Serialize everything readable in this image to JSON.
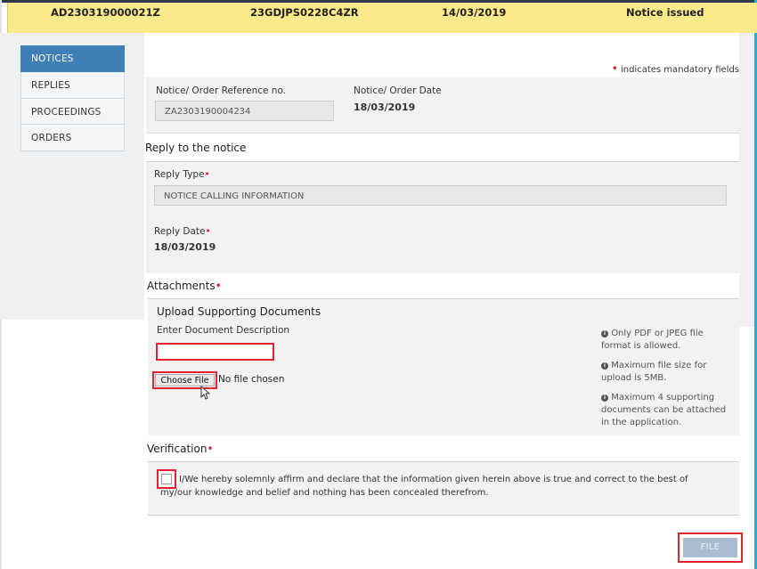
{
  "header": {
    "reference_id": "AD230319000021Z",
    "gstin": "23GDJPS0228C4ZR",
    "date": "14/03/2019",
    "status": "Notice issued"
  },
  "sidebar": {
    "items": [
      {
        "label": "NOTICES",
        "active": true
      },
      {
        "label": "REPLIES",
        "active": false
      },
      {
        "label": "PROCEEDINGS",
        "active": false
      },
      {
        "label": "ORDERS",
        "active": false
      }
    ]
  },
  "mandatory_note": "indicates mandatory fields",
  "notice": {
    "ref_label": "Notice/ Order Reference no.",
    "ref_value": "ZA2303190004234",
    "date_label": "Notice/ Order Date",
    "date_value": "18/03/2019"
  },
  "reply": {
    "section_title": "Reply to the notice",
    "type_label": "Reply Type",
    "type_value": "NOTICE CALLING INFORMATION",
    "date_label": "Reply Date",
    "date_value": "18/03/2019"
  },
  "attachments": {
    "section_title": "Attachments",
    "upload_title": "Upload Supporting Documents",
    "desc_label": "Enter Document Description",
    "desc_value": "",
    "choose_file_label": "Choose File",
    "no_file_text": "No file chosen",
    "info": [
      "Only PDF or JPEG file format is allowed.",
      "Maximum file size for upload is 5MB.",
      "Maximum 4 supporting documents can be attached in the application."
    ]
  },
  "verification": {
    "section_title": "Verification",
    "declaration": "I/We hereby solemnly affirm and declare that the information given herein above is true and correct to the best of my/our knowledge and belief and nothing has been concealed therefrom.",
    "checked": false
  },
  "actions": {
    "file_label": "FILE"
  },
  "colors": {
    "header_bg": "#fbea8c",
    "active_nav": "#3f7fb7",
    "required": "#d8202c",
    "highlight": "#e0232e",
    "file_button": "#a9bcd0"
  }
}
